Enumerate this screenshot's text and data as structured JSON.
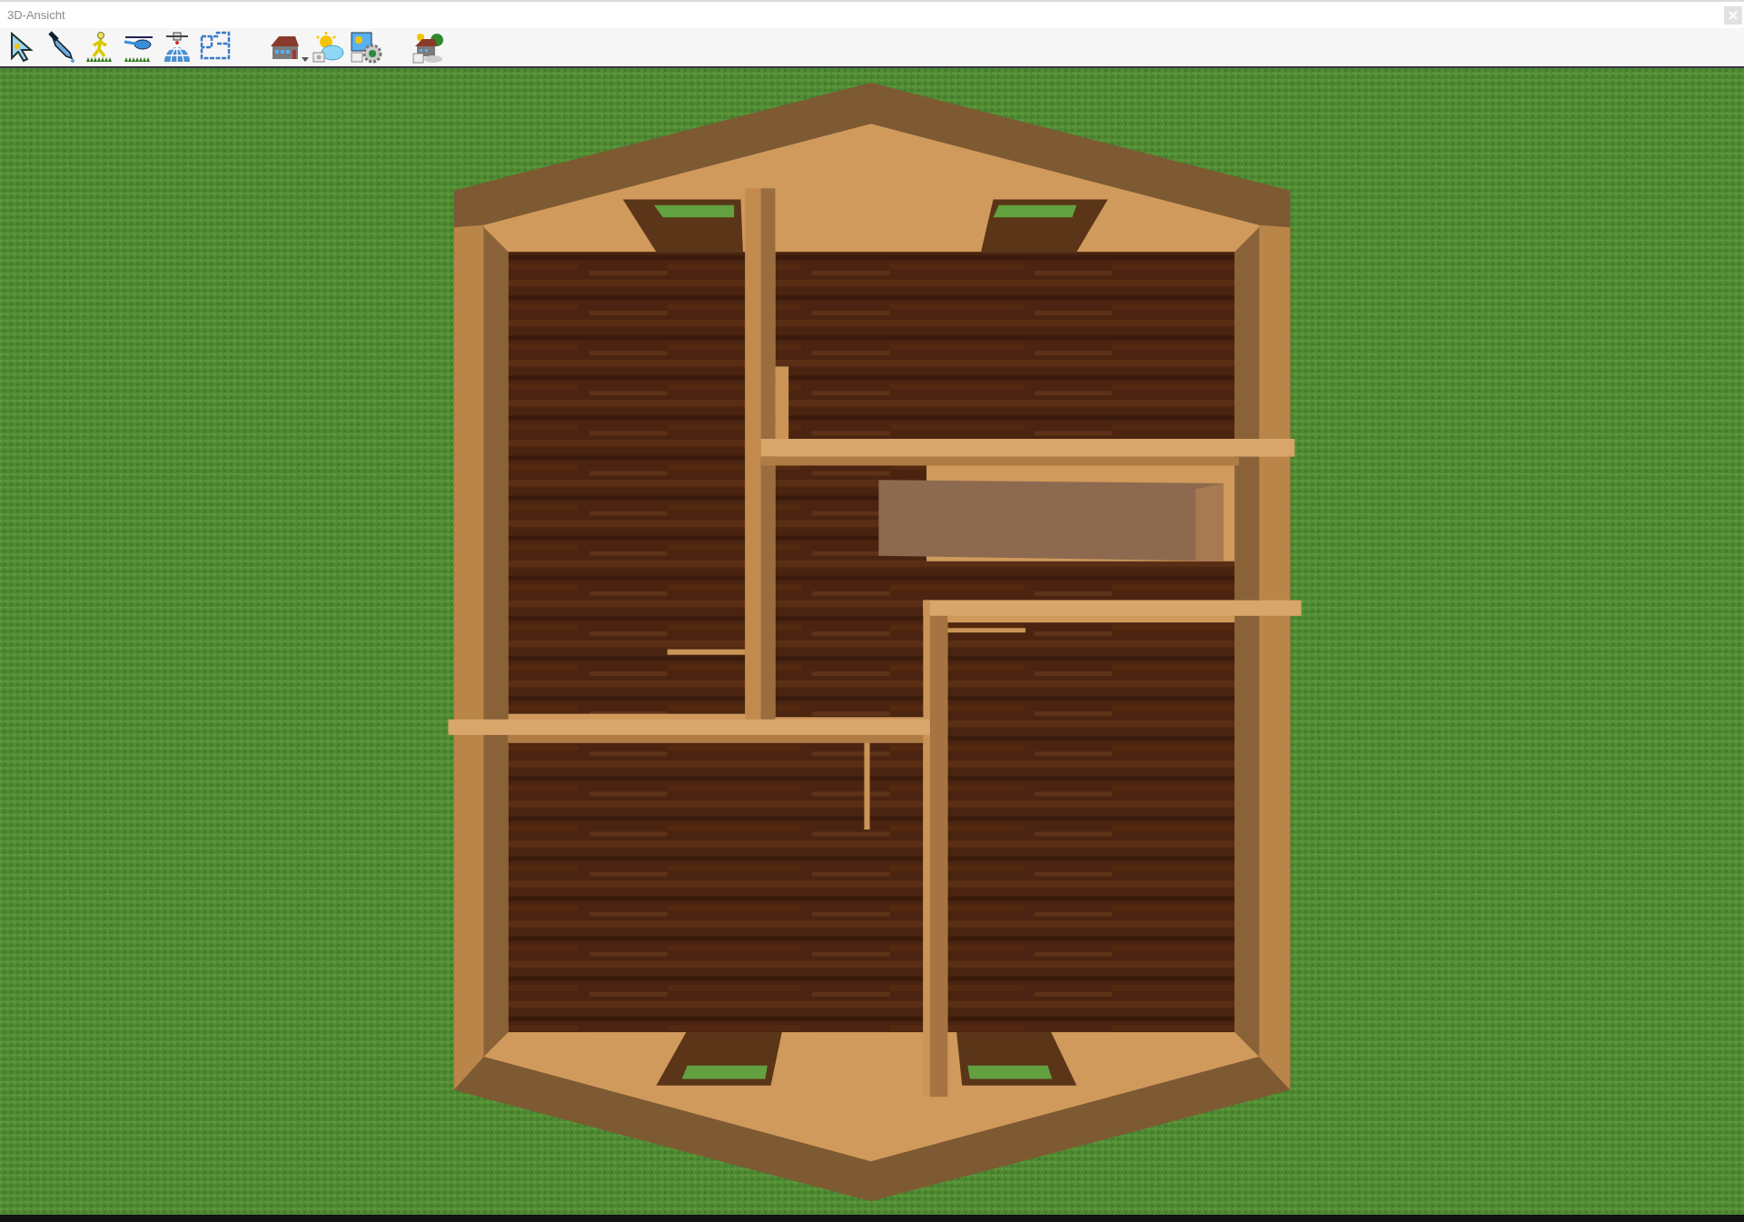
{
  "window": {
    "title": "3D-Ansicht"
  }
}
